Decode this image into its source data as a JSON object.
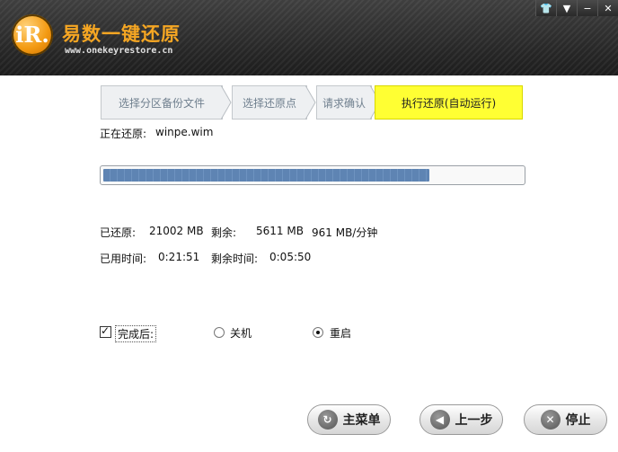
{
  "app": {
    "logo_text": "iR.",
    "title": "易数一键还原",
    "url": "www.onekeyrestore.cn"
  },
  "window_buttons": {
    "skin": "👕",
    "menu": "▼",
    "minimize": "−",
    "close": "✕"
  },
  "steps": [
    {
      "label": "选择分区备份文件",
      "active": false
    },
    {
      "label": "选择还原点",
      "active": false
    },
    {
      "label": "请求确认",
      "active": false
    },
    {
      "label": "执行还原(自动运行)",
      "active": true
    }
  ],
  "restoring": {
    "label": "正在还原:",
    "file": "winpe.wim"
  },
  "progress": {
    "fraction": 0.78
  },
  "stats": {
    "restored_label": "已还原:",
    "restored_value": "21002 MB",
    "remaining_label": "剩余:",
    "remaining_value": "5611 MB",
    "speed": "961 MB/分钟",
    "elapsed_label": "已用时间:",
    "elapsed_value": "0:21:51",
    "remaining_time_label": "剩余时间:",
    "remaining_time_value": "0:05:50"
  },
  "after_complete": {
    "label": "完成后:",
    "checked": true,
    "options": [
      {
        "label": "关机",
        "selected": false
      },
      {
        "label": "重启",
        "selected": true
      }
    ]
  },
  "buttons": {
    "main_menu": "主菜单",
    "previous": "上一步",
    "stop": "停止"
  }
}
